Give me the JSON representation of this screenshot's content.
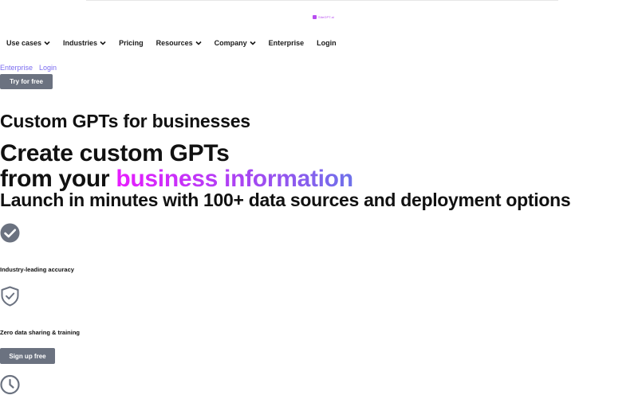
{
  "brand": {
    "logo_text": "SiteGPT.ai",
    "accent": "#b84ef0"
  },
  "nav": {
    "items": [
      {
        "label": "Use cases",
        "has_dropdown": true
      },
      {
        "label": "Industries",
        "has_dropdown": true
      },
      {
        "label": "Pricing",
        "has_dropdown": false
      },
      {
        "label": "Resources",
        "has_dropdown": true
      },
      {
        "label": "Company",
        "has_dropdown": true
      },
      {
        "label": "Enterprise",
        "has_dropdown": false
      },
      {
        "label": "Login",
        "has_dropdown": false
      }
    ]
  },
  "secondary_links": {
    "enterprise": "Enterprise",
    "login": "Login",
    "color": "#7b6cf0"
  },
  "cta": {
    "try_label": "Try for free",
    "signup_label": "Sign up free",
    "button_color": "#6b7280"
  },
  "hero": {
    "subtitle": "Custom GPTs for businesses",
    "headline_prefix": "Create ",
    "headline_bold": "custom GPTs",
    "headline_line2_prefix": "from your ",
    "headline_highlight": "business information",
    "tagline": "Launch in minutes with 100+ data sources and deployment options",
    "gradient": [
      "#e81cff",
      "#a746f2",
      "#6e72ea"
    ]
  },
  "features": [
    {
      "icon": "check-circle-icon",
      "label": "Industry-leading accuracy"
    },
    {
      "icon": "shield-check-icon",
      "label": "Zero data sharing & training"
    },
    {
      "icon": "clock-icon",
      "label": ""
    }
  ]
}
